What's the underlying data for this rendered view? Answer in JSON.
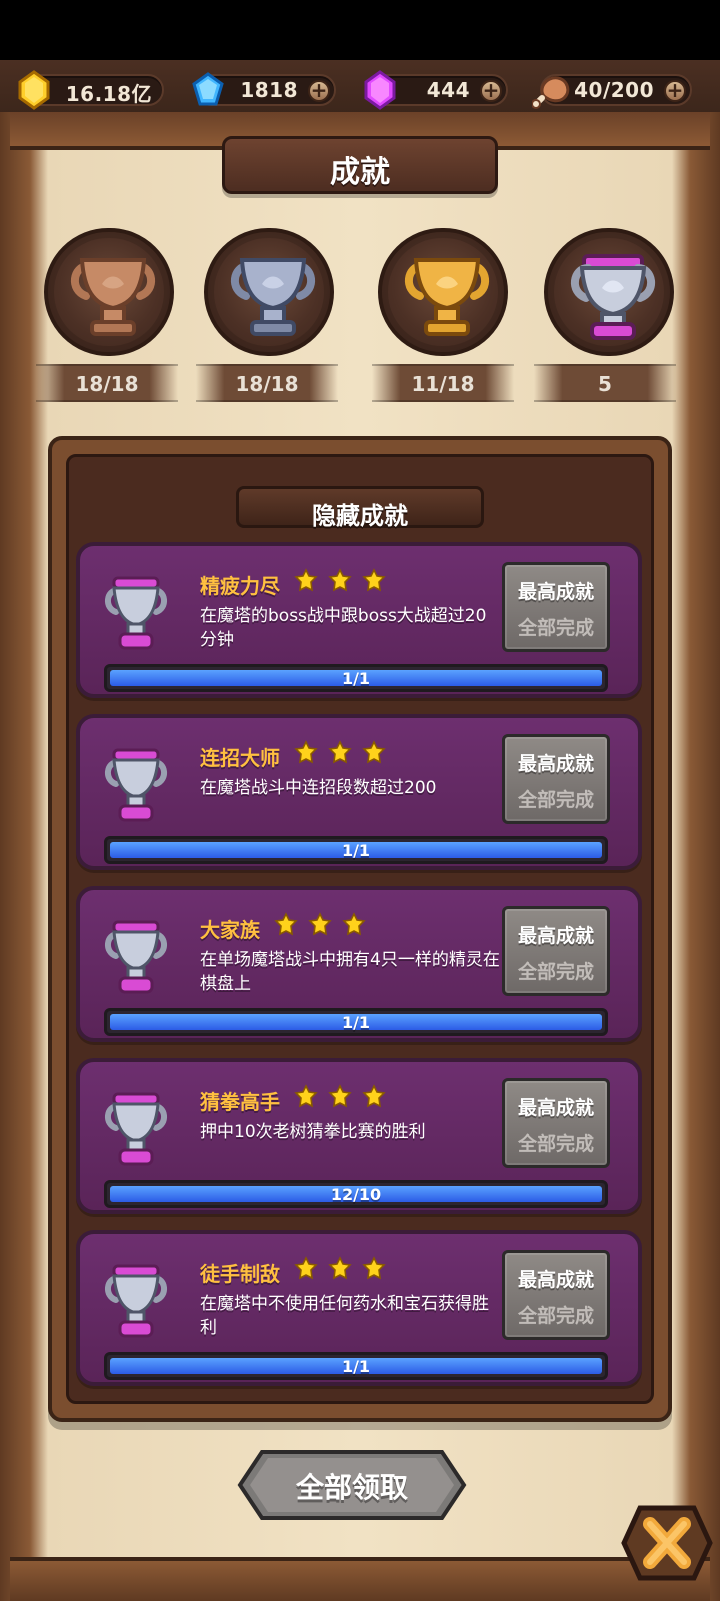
{
  "topbar": {
    "gold": {
      "value": "16.18亿",
      "icon": "gold-crystal-icon"
    },
    "diamond": {
      "value": "1818",
      "icon": "diamond-icon",
      "plus_label": "+"
    },
    "gem": {
      "value": "444",
      "icon": "purple-gem-icon",
      "plus_label": "+"
    },
    "stamina": {
      "value": "40/200",
      "icon": "meat-icon",
      "plus_label": "+"
    }
  },
  "page": {
    "title": "成就"
  },
  "trophies": [
    {
      "name": "bronze",
      "count": "18/18"
    },
    {
      "name": "silver",
      "count": "18/18"
    },
    {
      "name": "gold",
      "count": "11/18"
    },
    {
      "name": "hidden",
      "count": "5"
    }
  ],
  "section": {
    "title": "隐藏成就"
  },
  "achievements": [
    {
      "title": "精疲力尽",
      "desc": "在魔塔的boss战中跟boss大战超过20分钟",
      "btn_top": "最高成就",
      "btn_bottom": "全部完成",
      "progress_text": "1/1",
      "progress_fraction": 1.0
    },
    {
      "title": "连招大师",
      "desc": "在魔塔战斗中连招段数超过200",
      "btn_top": "最高成就",
      "btn_bottom": "全部完成",
      "progress_text": "1/1",
      "progress_fraction": 1.0
    },
    {
      "title": "大家族",
      "desc": "在单场魔塔战斗中拥有4只一样的精灵在棋盘上",
      "btn_top": "最高成就",
      "btn_bottom": "全部完成",
      "progress_text": "1/1",
      "progress_fraction": 1.0
    },
    {
      "title": "猜拳高手",
      "desc": "押中10次老树猜拳比赛的胜利",
      "btn_top": "最高成就",
      "btn_bottom": "全部完成",
      "progress_text": "12/10",
      "progress_fraction": 1.0
    },
    {
      "title": "徒手制敌",
      "desc": "在魔塔中不使用任何药水和宝石获得胜利",
      "btn_top": "最高成就",
      "btn_bottom": "全部完成",
      "progress_text": "1/1",
      "progress_fraction": 1.0
    }
  ],
  "footer": {
    "claim_all": "全部领取"
  },
  "colors": {
    "accent_gold": "#ffc040",
    "progress_blue": "#2c5ce6",
    "card_purple": "#6d2f6f"
  }
}
